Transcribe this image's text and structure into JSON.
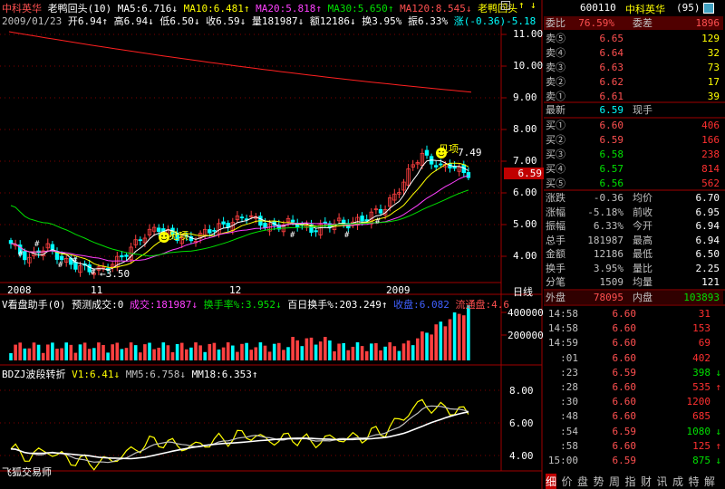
{
  "colors": {
    "up": "#ff4040",
    "down": "#00ffff",
    "ma5": "#ffffff",
    "ma10": "#ffff00",
    "ma20": "#ff40ff",
    "ma30": "#00e000",
    "ma120": "#ff2020",
    "grid": "#800000",
    "frame": "#a00000"
  },
  "top_bar": {
    "name": "中科英华",
    "pattern": "老鸭回头(10)",
    "ma5": "MA5:6.716",
    "ma10": "MA10:6.481",
    "ma20": "MA20:5.818",
    "ma30": "MA30:5.650",
    "ma120": "MA120:8.545",
    "pattern2": "老鸭回头"
  },
  "info_bar": {
    "date": "2009/01/23",
    "open": "开6.94",
    "high": "高6.94",
    "low": "低6.50",
    "close": "收6.59",
    "vol": "量181987",
    "amt": "额12186",
    "turn": "换3.95%",
    "amp": "振6.33%",
    "chg": "涨(-0.36)-5.18"
  },
  "price_axis": {
    "ticks": [
      "11.00",
      "10.00",
      "9.00",
      "8.00",
      "7.00",
      "6.00",
      "5.00",
      "4.00"
    ],
    "current": "6.59"
  },
  "annotations": {
    "peak": "7.49",
    "low": "3.50",
    "smiley1": "见项",
    "smiley2": "见项"
  },
  "time_axis": {
    "labels": [
      "2008",
      "11",
      "12",
      "2009"
    ],
    "period": "日线"
  },
  "vol_panel": {
    "title": "V看盘助手(0)",
    "forecast": "预测成交:0",
    "vol": "成交:181987",
    "turn": "换手率%:3.952",
    "turn100": "百日换手%:203.249",
    "close": "收盘:6.082",
    "float": "流通盘:4.6",
    "ticks": [
      "400000",
      "200000"
    ]
  },
  "ind_panel": {
    "title": "BDZJ波段转折",
    "v1": "V1:6.41",
    "mm5": "MM5:6.758",
    "mm18": "MM18:6.353",
    "ticks": [
      "8.00",
      "6.00",
      "4.00"
    ],
    "watermark": "飞狐交易师"
  },
  "chart_data": {
    "type": "candlestick",
    "x_labels": [
      "2008",
      "11",
      "12",
      "2009"
    ],
    "ylim": [
      3.2,
      11.5
    ],
    "last_close": 6.59,
    "max_label": 7.49,
    "min_label": 3.5
  },
  "quote": {
    "code": "600110",
    "name": "中科英华",
    "num": "(95)",
    "weibi": {
      "label": "委比",
      "value": "76.59%",
      "l2": "委差",
      "v2": "1896"
    },
    "sells": [
      {
        "label": "卖⑤",
        "price": "6.65",
        "vol": "129"
      },
      {
        "label": "卖④",
        "price": "6.64",
        "vol": "32"
      },
      {
        "label": "卖③",
        "price": "6.63",
        "vol": "73"
      },
      {
        "label": "卖②",
        "price": "6.62",
        "vol": "17"
      },
      {
        "label": "卖①",
        "price": "6.61",
        "vol": "39"
      }
    ],
    "last": {
      "label": "最新",
      "price": "6.59",
      "tail": "现手"
    },
    "buys": [
      {
        "label": "买①",
        "price": "6.60",
        "vol": "406"
      },
      {
        "label": "买②",
        "price": "6.59",
        "vol": "166"
      },
      {
        "label": "买③",
        "price": "6.58",
        "vol": "238"
      },
      {
        "label": "买④",
        "price": "6.57",
        "vol": "814"
      },
      {
        "label": "买⑤",
        "price": "6.56",
        "vol": "562"
      }
    ],
    "stats": [
      {
        "l1": "涨跌",
        "v1": "-0.36",
        "l2": "均价",
        "v2": "6.70"
      },
      {
        "l1": "涨幅",
        "v1": "-5.18%",
        "l2": "前收",
        "v2": "6.95"
      },
      {
        "l1": "振幅",
        "v1": "6.33%",
        "l2": "今开",
        "v2": "6.94"
      },
      {
        "l1": "总手",
        "v1": "181987",
        "l2": "最高",
        "v2": "6.94"
      },
      {
        "l1": "金额",
        "v1": "12186",
        "l2": "最低",
        "v2": "6.50"
      },
      {
        "l1": "换手",
        "v1": "3.95%",
        "l2": "量比",
        "v2": "2.25"
      },
      {
        "l1": "分笔",
        "v1": "1509",
        "l2": "均量",
        "v2": "121"
      }
    ],
    "waipan": {
      "label": "外盘",
      "value": "78095",
      "l2": "内盘",
      "v2": "103893"
    },
    "ticks": [
      {
        "t": "14:58",
        "p": "6.60",
        "v": "31",
        "d": ""
      },
      {
        "t": "14:58",
        "p": "6.60",
        "v": "153",
        "d": ""
      },
      {
        "t": "14:59",
        "p": "6.60",
        "v": "69",
        "d": ""
      },
      {
        "t": ":01",
        "p": "6.60",
        "v": "402",
        "d": ""
      },
      {
        "t": ":23",
        "p": "6.59",
        "v": "398",
        "d": "↓"
      },
      {
        "t": ":28",
        "p": "6.60",
        "v": "535",
        "d": "↑"
      },
      {
        "t": ":30",
        "p": "6.60",
        "v": "1200",
        "d": ""
      },
      {
        "t": ":48",
        "p": "6.60",
        "v": "685",
        "d": ""
      },
      {
        "t": ":54",
        "p": "6.59",
        "v": "1080",
        "d": "↓"
      },
      {
        "t": ":58",
        "p": "6.60",
        "v": "125",
        "d": "↑"
      },
      {
        "t": "15:00",
        "p": "6.59",
        "v": "875",
        "d": "↓"
      }
    ],
    "tabs": [
      "细",
      "价",
      "盘",
      "势",
      "周",
      "指",
      "财",
      "讯",
      "成",
      "特",
      "解"
    ]
  }
}
